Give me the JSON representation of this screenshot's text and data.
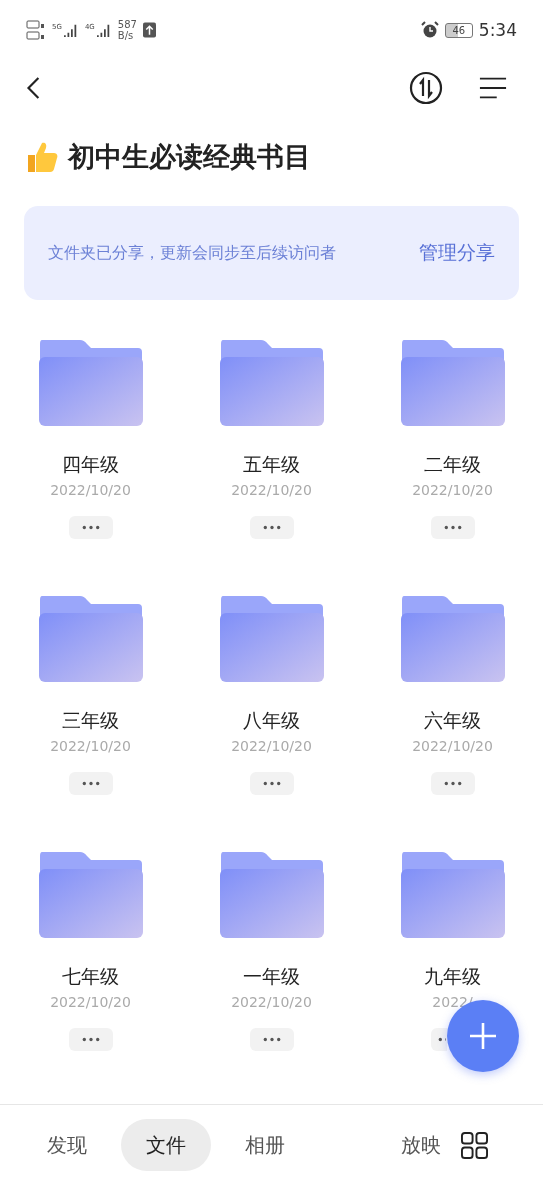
{
  "status_bar": {
    "network_5g": "5G",
    "network_4g": "4G",
    "speed_value": "587",
    "speed_unit": "B/s",
    "battery": "46",
    "time": "5:34"
  },
  "title": "初中生必读经典书目",
  "share_banner": {
    "message": "文件夹已分享，更新会同步至后续访问者",
    "action": "管理分享"
  },
  "folders": [
    {
      "name": "四年级",
      "date": "2022/10/20"
    },
    {
      "name": "五年级",
      "date": "2022/10/20"
    },
    {
      "name": "二年级",
      "date": "2022/10/20"
    },
    {
      "name": "三年级",
      "date": "2022/10/20"
    },
    {
      "name": "八年级",
      "date": "2022/10/20"
    },
    {
      "name": "六年级",
      "date": "2022/10/20"
    },
    {
      "name": "七年级",
      "date": "2022/10/20"
    },
    {
      "name": "一年级",
      "date": "2022/10/20"
    },
    {
      "name": "九年级",
      "date": "2022/"
    }
  ],
  "bottom_nav": [
    {
      "label": "发现",
      "selected": false
    },
    {
      "label": "文件",
      "selected": true
    },
    {
      "label": "相册",
      "selected": false
    },
    {
      "label": "放映",
      "selected": false
    }
  ]
}
